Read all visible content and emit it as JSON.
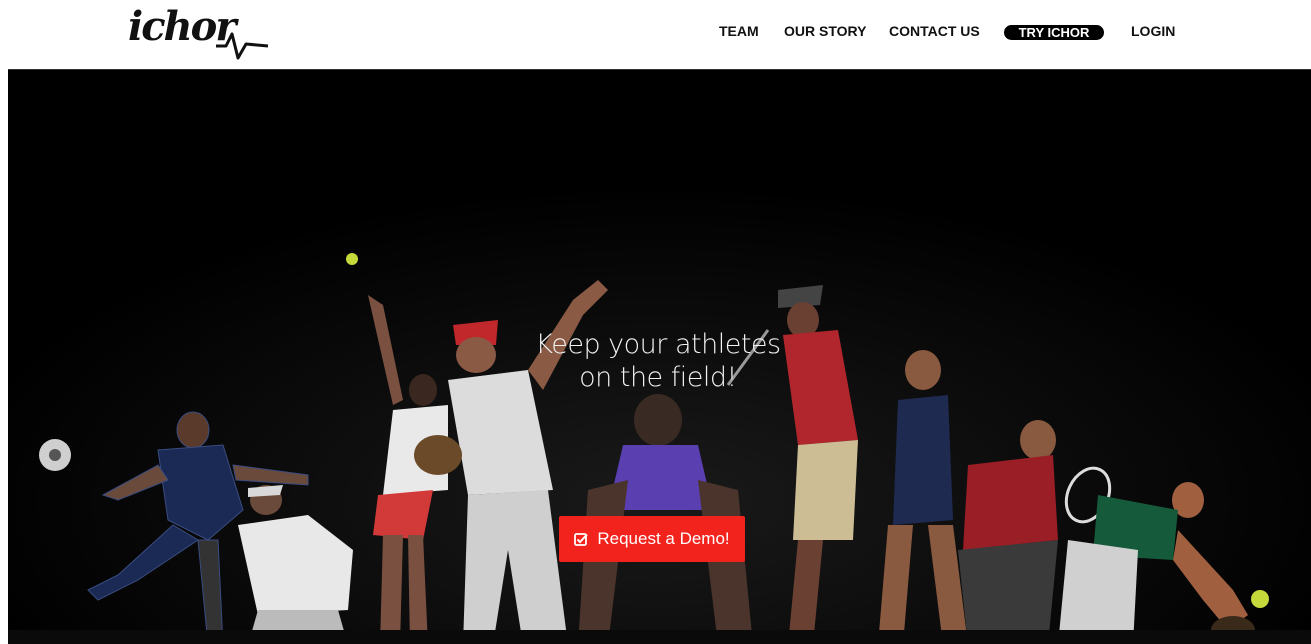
{
  "header": {
    "logo_text": "ichor",
    "nav": {
      "team": "TEAM",
      "our_story": "OUR STORY",
      "contact_us": "CONTACT US",
      "try_ichor": "TRY ICHOR",
      "login": "LOGIN"
    }
  },
  "hero": {
    "headline_line1": "Keep your athletes",
    "headline_line2": "on the field!",
    "cta_label": "Request a Demo!",
    "cta_icon": "check-square-icon",
    "background_image": "athletes-silhouette-photo"
  },
  "colors": {
    "hero_background": "#000000",
    "cta_background": "#f2231c",
    "nav_text": "#111111"
  }
}
